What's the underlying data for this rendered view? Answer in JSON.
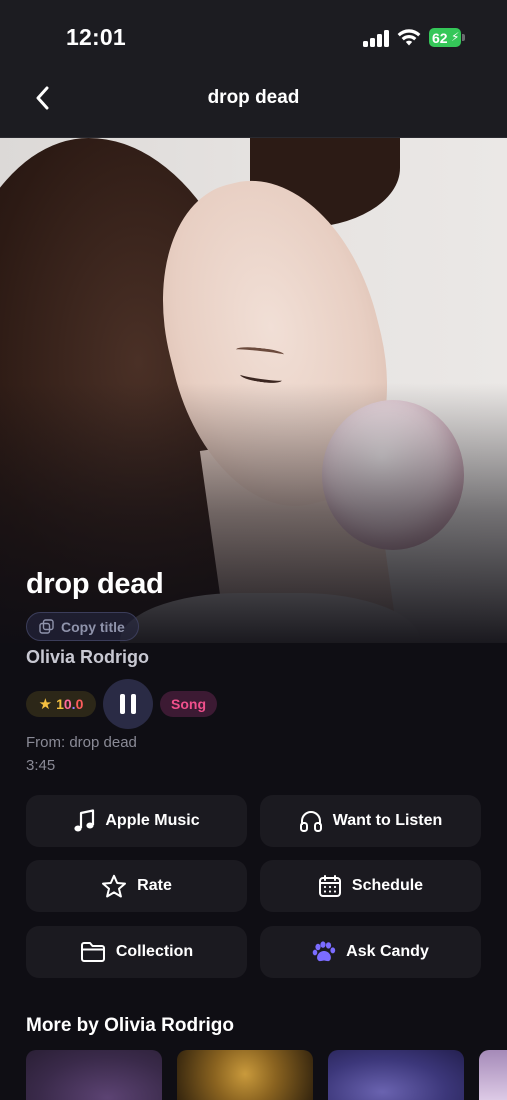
{
  "status_bar": {
    "time": "12:01",
    "battery_level": "62",
    "icons": [
      "signal-icon",
      "wifi-icon",
      "battery-icon"
    ]
  },
  "nav": {
    "title": "drop dead",
    "back_icon": "chevron-left-icon"
  },
  "track": {
    "title": "drop dead",
    "copy_label": "Copy title",
    "artist": "Olivia Rodrigo",
    "rating": "10.0",
    "type_badge": "Song",
    "from": "From: drop dead",
    "duration": "3:45"
  },
  "actions": [
    {
      "label": "Apple Music",
      "icon": "music-note-icon"
    },
    {
      "label": "Want to Listen",
      "icon": "headphones-icon"
    },
    {
      "label": "Rate",
      "icon": "star-outline-icon"
    },
    {
      "label": "Schedule",
      "icon": "calendar-icon"
    },
    {
      "label": "Collection",
      "icon": "folder-icon"
    },
    {
      "label": "Ask Candy",
      "icon": "paw-icon"
    }
  ],
  "more_by": {
    "title": "More by Olivia Rodrigo"
  },
  "colors": {
    "background": "#0f0e14",
    "card": "#1b1a20",
    "rating_gold": "#f5c040",
    "badge_pink": "#f0508c",
    "paw_purple": "#7b6cff",
    "battery_green": "#35c759"
  }
}
